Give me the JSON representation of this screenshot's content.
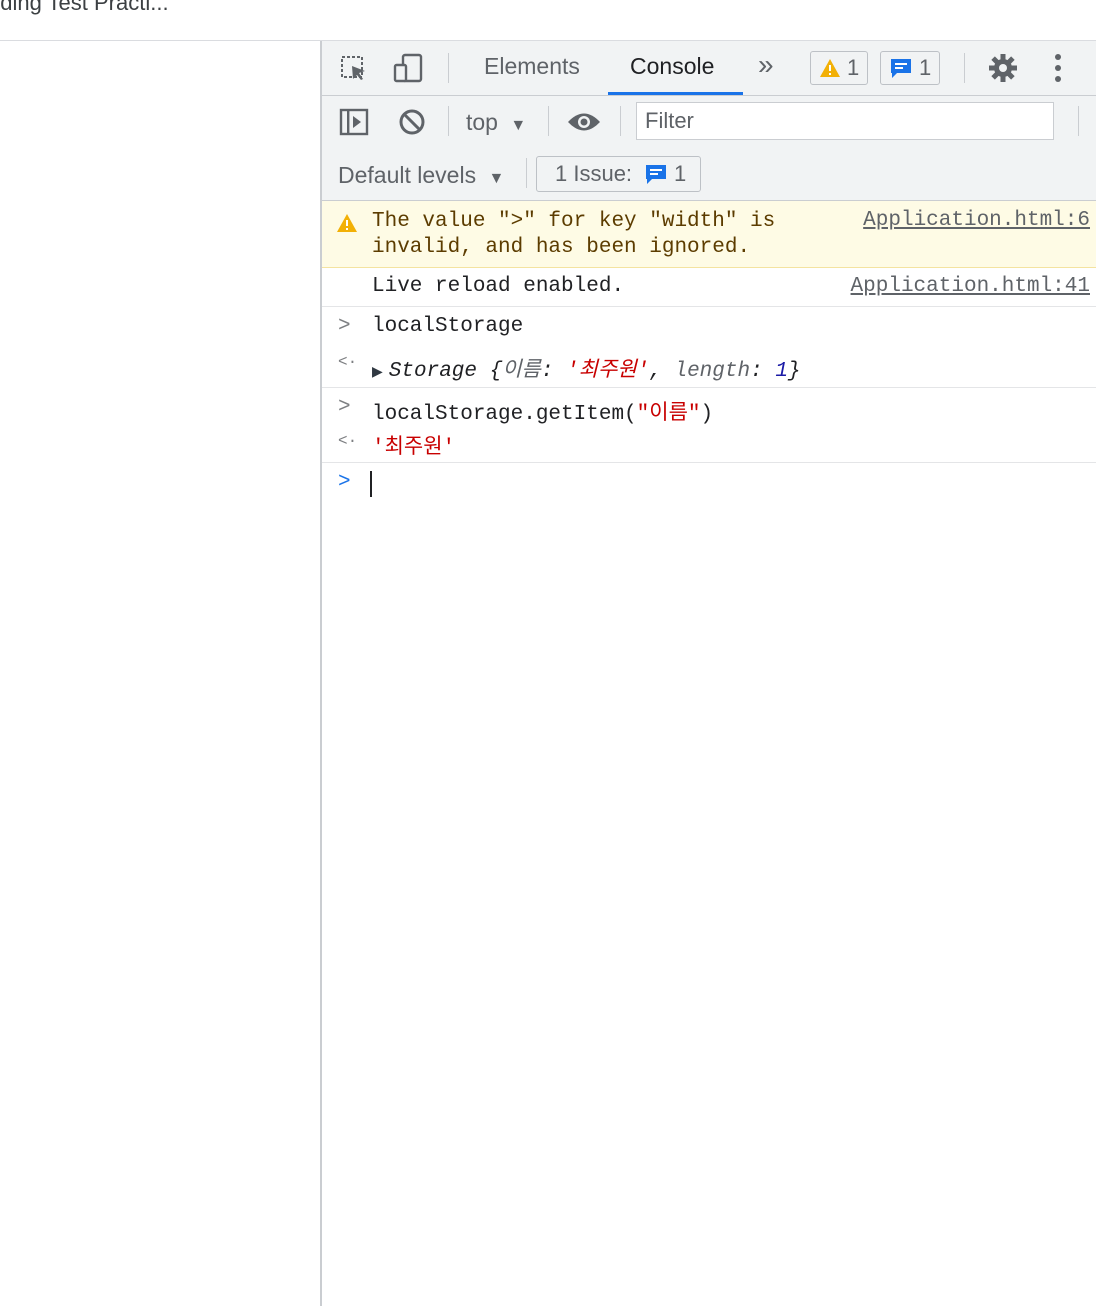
{
  "browser": {
    "tab_title": "oding Test Practi..."
  },
  "devtools": {
    "tabs": [
      "Elements",
      "Console"
    ],
    "more_tabs": "»",
    "warnings_count": "1",
    "issues_count": "1",
    "context": "top",
    "filter_placeholder": "Filter",
    "levels": "Default levels",
    "issue_label": "1 Issue:",
    "issue_count": "1"
  },
  "console": {
    "warning": {
      "line1": "The value \">\" for key \"width\" is",
      "line2": "invalid, and has been ignored.",
      "source": "Application.html:6"
    },
    "log": {
      "text": "Live reload enabled.",
      "source": "Application.html:41"
    },
    "input1": "localStorage",
    "result1": {
      "type": "Storage",
      "open": "{",
      "key": "이름",
      "colon": ": ",
      "value": "'최주원'",
      "comma": ", ",
      "length_key": "length",
      "length_colon": ": ",
      "length_val": "1",
      "close": "}"
    },
    "input2_prefix": "localStorage.getItem(",
    "input2_arg": "\"이름\"",
    "input2_suffix": ")",
    "result2": "'최주원'"
  },
  "colors": {
    "accent": "#1a73e8",
    "warning_bg": "#fefbe5",
    "warning_text": "#5c3c00",
    "string_red": "#c80000",
    "number_blue": "#1a1aa6"
  }
}
